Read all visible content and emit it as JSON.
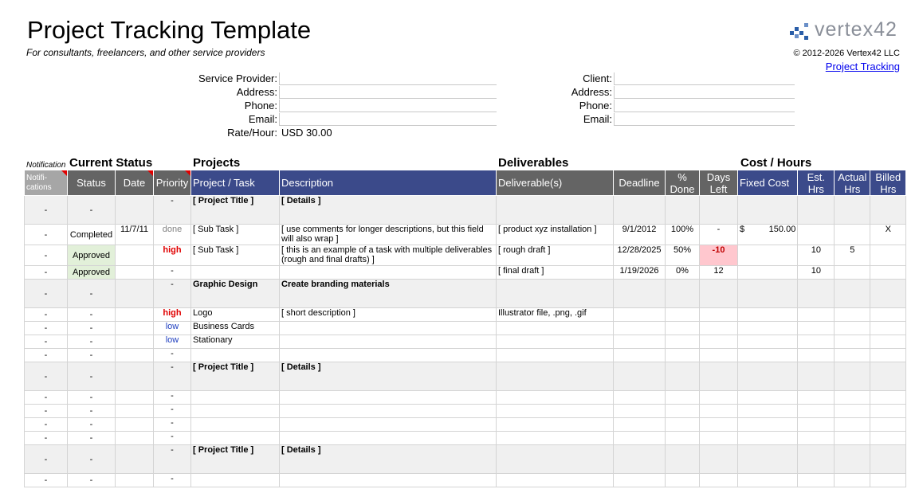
{
  "header": {
    "title": "Project Tracking Template",
    "subtitle": "For consultants, freelancers, and other service providers",
    "logo_text": "vertex42",
    "copyright": "© 2012-2026 Vertex42 LLC",
    "link": "Project Tracking"
  },
  "form": {
    "left": [
      {
        "label": "Service Provider:",
        "value": ""
      },
      {
        "label": "Address:",
        "value": ""
      },
      {
        "label": "Phone:",
        "value": ""
      },
      {
        "label": "Email:",
        "value": ""
      },
      {
        "label": "Rate/Hour:",
        "value": "USD 30.00"
      }
    ],
    "right": [
      {
        "label": "Client:",
        "value": ""
      },
      {
        "label": "Address:",
        "value": ""
      },
      {
        "label": "Phone:",
        "value": ""
      },
      {
        "label": "Email:",
        "value": ""
      }
    ]
  },
  "sections": {
    "notifications": "Notification",
    "status": "Current Status",
    "projects": "Projects",
    "deliverables": "Deliverables",
    "cost": "Cost / Hours"
  },
  "columns": [
    "Notifi-cations",
    "Status",
    "Date",
    "Priority",
    "Project / Task",
    "Description",
    "Deliverable(s)",
    "Deadline",
    "% Done",
    "Days Left",
    "Fixed Cost",
    "Est. Hrs",
    "Actual Hrs",
    "Billed Hrs"
  ],
  "rows": [
    {
      "type": "proj",
      "notif": "-",
      "status": "-",
      "date": "",
      "priority": "-",
      "task": "[ Project Title ]",
      "desc": "[ Details ]",
      "deliv": "",
      "deadline": "",
      "pct": "",
      "days": "",
      "cost": "",
      "est": "",
      "actual": "",
      "billed": ""
    },
    {
      "type": "task",
      "notif": "-",
      "status": "Completed",
      "date": "11/7/11",
      "priority": "done",
      "task": "[ Sub Task ]",
      "desc": "[ use comments for longer descriptions, but this field will also wrap ]",
      "deliv": "[ product xyz installation ]",
      "deadline": "9/1/2012",
      "pct": "100%",
      "days": "-",
      "cost": "$          150.00",
      "est": "",
      "actual": "",
      "billed": "X"
    },
    {
      "type": "task",
      "notif": "-",
      "status": "Approved",
      "date": "",
      "priority": "high",
      "task": "[ Sub Task ]",
      "desc": "[ this is an example of a task with multiple deliverables (rough and final drafts) ]",
      "deliv": "[ rough draft ]",
      "deadline": "12/28/2025",
      "pct": "50%",
      "days": "-10",
      "cost": "",
      "est": "10",
      "actual": "5",
      "billed": ""
    },
    {
      "type": "task",
      "notif": "-",
      "status": "Approved",
      "date": "",
      "priority": "-",
      "task": "",
      "desc": "",
      "deliv": "[ final draft ]",
      "deadline": "1/19/2026",
      "pct": "0%",
      "days": "12",
      "cost": "",
      "est": "10",
      "actual": "",
      "billed": ""
    },
    {
      "type": "proj",
      "notif": "-",
      "status": "-",
      "date": "",
      "priority": "-",
      "task": "Graphic Design",
      "desc": "Create branding materials",
      "deliv": "",
      "deadline": "",
      "pct": "",
      "days": "",
      "cost": "",
      "est": "",
      "actual": "",
      "billed": ""
    },
    {
      "type": "task",
      "notif": "-",
      "status": "-",
      "date": "",
      "priority": "high",
      "task": "Logo",
      "desc": "[ short description ]",
      "deliv": "Illustrator file, .png, .gif",
      "deadline": "",
      "pct": "",
      "days": "",
      "cost": "",
      "est": "",
      "actual": "",
      "billed": ""
    },
    {
      "type": "task",
      "notif": "-",
      "status": "-",
      "date": "",
      "priority": "low",
      "task": "Business Cards",
      "desc": "",
      "deliv": "",
      "deadline": "",
      "pct": "",
      "days": "",
      "cost": "",
      "est": "",
      "actual": "",
      "billed": ""
    },
    {
      "type": "task",
      "notif": "-",
      "status": "-",
      "date": "",
      "priority": "low",
      "task": "Stationary",
      "desc": "",
      "deliv": "",
      "deadline": "",
      "pct": "",
      "days": "",
      "cost": "",
      "est": "",
      "actual": "",
      "billed": ""
    },
    {
      "type": "task",
      "notif": "-",
      "status": "-",
      "date": "",
      "priority": "-",
      "task": "",
      "desc": "",
      "deliv": "",
      "deadline": "",
      "pct": "",
      "days": "",
      "cost": "",
      "est": "",
      "actual": "",
      "billed": ""
    },
    {
      "type": "proj",
      "notif": "-",
      "status": "-",
      "date": "",
      "priority": "-",
      "task": "[ Project Title ]",
      "desc": "[ Details ]",
      "deliv": "",
      "deadline": "",
      "pct": "",
      "days": "",
      "cost": "",
      "est": "",
      "actual": "",
      "billed": ""
    },
    {
      "type": "task",
      "notif": "-",
      "status": "-",
      "date": "",
      "priority": "-",
      "task": "",
      "desc": "",
      "deliv": "",
      "deadline": "",
      "pct": "",
      "days": "",
      "cost": "",
      "est": "",
      "actual": "",
      "billed": ""
    },
    {
      "type": "task",
      "notif": "-",
      "status": "-",
      "date": "",
      "priority": "-",
      "task": "",
      "desc": "",
      "deliv": "",
      "deadline": "",
      "pct": "",
      "days": "",
      "cost": "",
      "est": "",
      "actual": "",
      "billed": ""
    },
    {
      "type": "task",
      "notif": "-",
      "status": "-",
      "date": "",
      "priority": "-",
      "task": "",
      "desc": "",
      "deliv": "",
      "deadline": "",
      "pct": "",
      "days": "",
      "cost": "",
      "est": "",
      "actual": "",
      "billed": ""
    },
    {
      "type": "task",
      "notif": "-",
      "status": "-",
      "date": "",
      "priority": "-",
      "task": "",
      "desc": "",
      "deliv": "",
      "deadline": "",
      "pct": "",
      "days": "",
      "cost": "",
      "est": "",
      "actual": "",
      "billed": ""
    },
    {
      "type": "proj",
      "notif": "-",
      "status": "-",
      "date": "",
      "priority": "-",
      "task": "[ Project Title ]",
      "desc": "[ Details ]",
      "deliv": "",
      "deadline": "",
      "pct": "",
      "days": "",
      "cost": "",
      "est": "",
      "actual": "",
      "billed": ""
    },
    {
      "type": "task",
      "notif": "-",
      "status": "-",
      "date": "",
      "priority": "-",
      "task": "",
      "desc": "",
      "deliv": "",
      "deadline": "",
      "pct": "",
      "days": "",
      "cost": "",
      "est": "",
      "actual": "",
      "billed": ""
    }
  ],
  "colors": {
    "header_gray": "#646464",
    "header_blue": "#3b4a8a",
    "approved_fill": "#e2f0d9",
    "overdue_fill": "#ffc7ce",
    "high_priority": "#e00000",
    "low_priority": "#1f3fbf"
  }
}
